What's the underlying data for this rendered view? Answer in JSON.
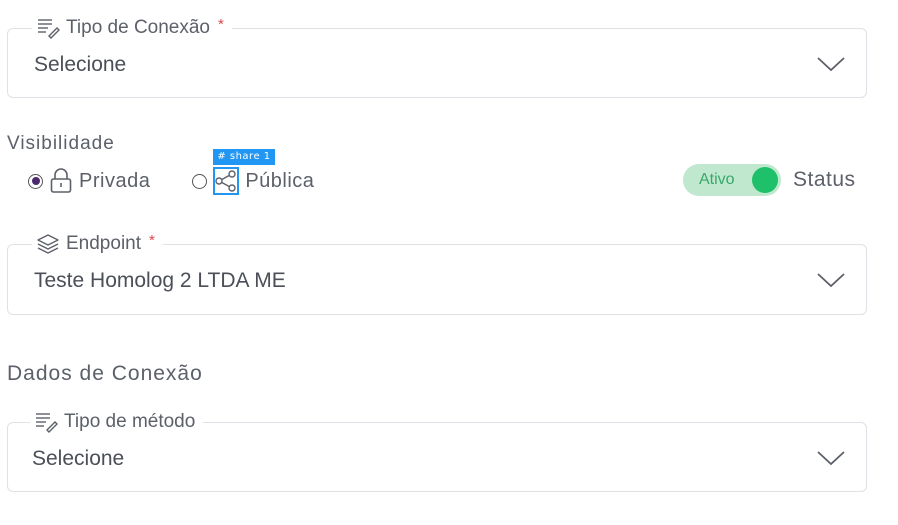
{
  "connection_type": {
    "label": "Tipo de Conexão",
    "required_mark": "*",
    "value": "Selecione",
    "icon": "edit-list-icon"
  },
  "visibility": {
    "label": "Visibilidade",
    "options": [
      {
        "label": "Privada",
        "icon": "lock-icon",
        "selected": true
      },
      {
        "label": "Pública",
        "icon": "share-icon",
        "selected": false
      }
    ],
    "dev_tag": "# share 1"
  },
  "status": {
    "toggle_label": "Ativo",
    "label": "Status",
    "on": true,
    "color": "#1ec06a"
  },
  "endpoint": {
    "label": "Endpoint",
    "required_mark": "*",
    "value": "Teste Homolog 2 LTDA ME",
    "icon": "layers-icon"
  },
  "connection_data": {
    "title": "Dados de Conexão"
  },
  "method_type": {
    "label": "Tipo de método",
    "value": "Selecione",
    "icon": "edit-list-icon"
  }
}
